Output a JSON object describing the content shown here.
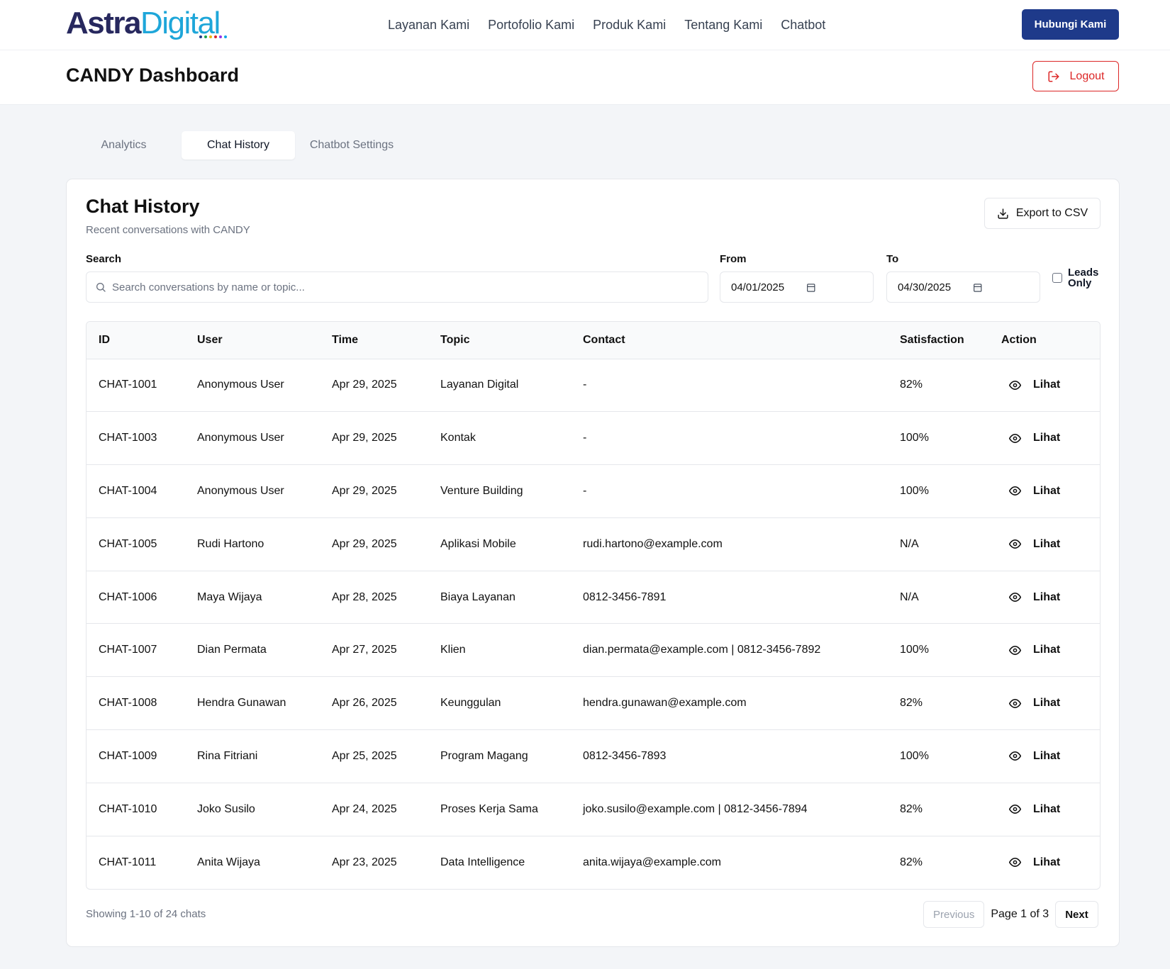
{
  "header": {
    "logo": {
      "part1": "Astra",
      "part2": "Digital"
    },
    "nav": [
      "Layanan Kami",
      "Portofolio Kami",
      "Produk Kami",
      "Tentang Kami",
      "Chatbot"
    ],
    "contact_label": "Hubungi Kami"
  },
  "dashboard": {
    "title": "CANDY Dashboard",
    "logout_label": "Logout"
  },
  "tabs": [
    "Analytics",
    "Chat History",
    "Chatbot Settings"
  ],
  "active_tab": "Chat History",
  "card": {
    "title": "Chat History",
    "subtitle": "Recent conversations with CANDY",
    "export_label": "Export to CSV"
  },
  "filters": {
    "search_label": "Search",
    "search_placeholder": "Search conversations by name or topic...",
    "search_value": "",
    "from_label": "From",
    "from_value": "04/01/2025",
    "to_label": "To",
    "to_value": "04/30/2025",
    "leads_label": "Leads Only",
    "leads_checked": false
  },
  "table": {
    "columns": [
      "ID",
      "User",
      "Time",
      "Topic",
      "Contact",
      "Satisfaction",
      "Action"
    ],
    "action_label": "Lihat",
    "rows": [
      {
        "id": "CHAT-1001",
        "user": "Anonymous User",
        "time": "Apr 29, 2025",
        "topic": "Layanan Digital",
        "contact": "-",
        "satisfaction": "82%"
      },
      {
        "id": "CHAT-1003",
        "user": "Anonymous User",
        "time": "Apr 29, 2025",
        "topic": "Kontak",
        "contact": "-",
        "satisfaction": "100%"
      },
      {
        "id": "CHAT-1004",
        "user": "Anonymous User",
        "time": "Apr 29, 2025",
        "topic": "Venture Building",
        "contact": "-",
        "satisfaction": "100%"
      },
      {
        "id": "CHAT-1005",
        "user": "Rudi Hartono",
        "time": "Apr 29, 2025",
        "topic": "Aplikasi Mobile",
        "contact": "rudi.hartono@example.com",
        "satisfaction": "N/A"
      },
      {
        "id": "CHAT-1006",
        "user": "Maya Wijaya",
        "time": "Apr 28, 2025",
        "topic": "Biaya Layanan",
        "contact": "0812-3456-7891",
        "satisfaction": "N/A"
      },
      {
        "id": "CHAT-1007",
        "user": "Dian Permata",
        "time": "Apr 27, 2025",
        "topic": "Klien",
        "contact": "dian.permata@example.com | 0812-3456-7892",
        "satisfaction": "100%"
      },
      {
        "id": "CHAT-1008",
        "user": "Hendra Gunawan",
        "time": "Apr 26, 2025",
        "topic": "Keunggulan",
        "contact": "hendra.gunawan@example.com",
        "satisfaction": "82%"
      },
      {
        "id": "CHAT-1009",
        "user": "Rina Fitriani",
        "time": "Apr 25, 2025",
        "topic": "Program Magang",
        "contact": "0812-3456-7893",
        "satisfaction": "100%"
      },
      {
        "id": "CHAT-1010",
        "user": "Joko Susilo",
        "time": "Apr 24, 2025",
        "topic": "Proses Kerja Sama",
        "contact": "joko.susilo@example.com | 0812-3456-7894",
        "satisfaction": "82%"
      },
      {
        "id": "CHAT-1011",
        "user": "Anita Wijaya",
        "time": "Apr 23, 2025",
        "topic": "Data Intelligence",
        "contact": "anita.wijaya@example.com",
        "satisfaction": "82%"
      }
    ]
  },
  "pagination": {
    "showing": "Showing 1-10 of 24 chats",
    "previous_label": "Previous",
    "page_info": "Page 1 of 3",
    "next_label": "Next"
  },
  "colors": {
    "primary": "#1e3a8a",
    "logout": "#dc2626",
    "logo_dark": "#27285e",
    "logo_light": "#1ea6d9",
    "page_bg": "#f3f5f8"
  },
  "icons": {
    "logout": "logout-icon",
    "export": "download-icon",
    "search": "search-icon",
    "calendar": "calendar-icon",
    "view": "eye-icon"
  }
}
